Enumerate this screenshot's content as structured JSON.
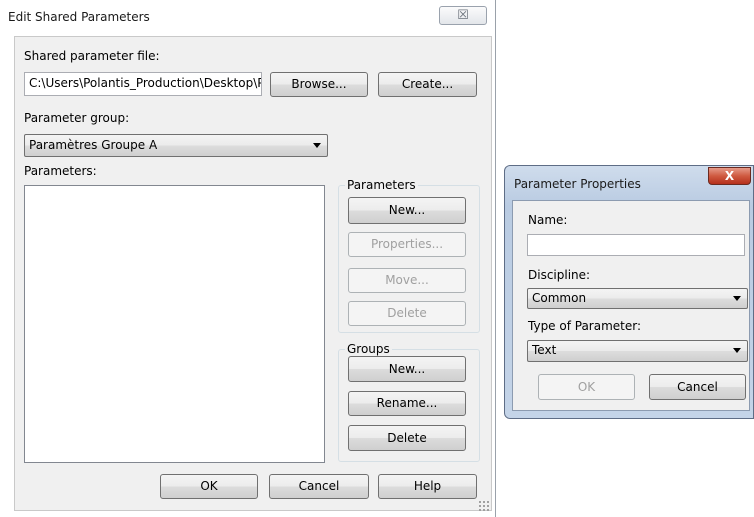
{
  "edit_dialog": {
    "title": "Edit Shared Parameters",
    "close_glyph": "☒",
    "file_label": "Shared parameter file:",
    "file_path": "C:\\Users\\Polantis_Production\\Desktop\\Pa",
    "browse_label": "Browse...",
    "create_label": "Create...",
    "group_label": "Parameter group:",
    "group_selected": "Paramètres Groupe A",
    "parameters_label": "Parameters:",
    "parameters_box": {
      "title": "Parameters",
      "new_label": "New...",
      "properties_label": "Properties...",
      "move_label": "Move...",
      "delete_label": "Delete"
    },
    "groups_box": {
      "title": "Groups",
      "new_label": "New...",
      "rename_label": "Rename...",
      "delete_label": "Delete"
    },
    "ok_label": "OK",
    "cancel_label": "Cancel",
    "help_label": "Help"
  },
  "properties_dialog": {
    "title": "Parameter Properties",
    "close_glyph": "X",
    "name_label": "Name:",
    "name_value": "",
    "discipline_label": "Discipline:",
    "discipline_selected": "Common",
    "type_label": "Type of Parameter:",
    "type_selected": "Text",
    "ok_label": "OK",
    "cancel_label": "Cancel"
  }
}
